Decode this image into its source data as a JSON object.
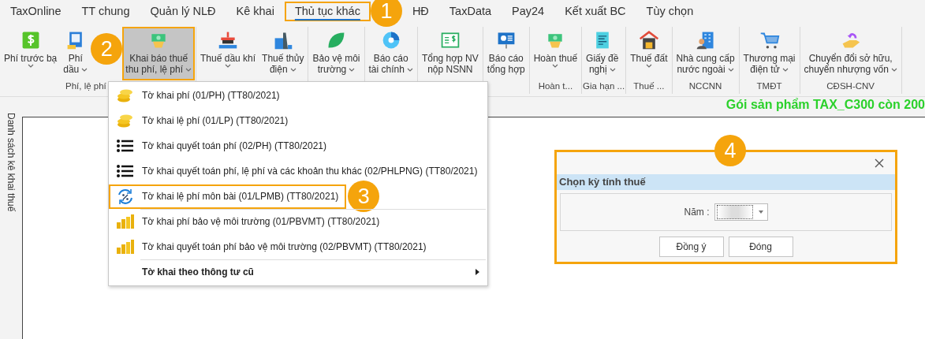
{
  "tabs": [
    {
      "label": "TaxOnline",
      "selected": false,
      "highlighted": false
    },
    {
      "label": "TT chung",
      "selected": false,
      "highlighted": false
    },
    {
      "label": "Quản lý NLĐ",
      "selected": false,
      "highlighted": false
    },
    {
      "label": "Kê khai",
      "selected": false,
      "highlighted": false
    },
    {
      "label": "Thủ tục khác",
      "selected": true,
      "highlighted": true,
      "callout": "1"
    },
    {
      "label": "HĐ",
      "selected": false,
      "highlighted": false
    },
    {
      "label": "TaxData",
      "selected": false,
      "highlighted": false
    },
    {
      "label": "Pay24",
      "selected": false,
      "highlighted": false
    },
    {
      "label": "Kết xuất BC",
      "selected": false,
      "highlighted": false
    },
    {
      "label": "Tùy chọn",
      "selected": false,
      "highlighted": false
    }
  ],
  "ribbon": {
    "groups": [
      {
        "label": "Phí, lệ phí",
        "buttons": [
          {
            "lines": [
              "Phí trước bạ"
            ],
            "dropdown": true,
            "highlighted": false
          },
          {
            "lines": [
              "Phí",
              "dầu"
            ],
            "dropdown": true,
            "highlighted": false
          },
          {
            "lines": [
              "Khai báo thuế",
              "thu phí, lệ phí"
            ],
            "dropdown": true,
            "highlighted": true,
            "callout": "2"
          }
        ]
      },
      {
        "buttons": [
          {
            "lines": [
              "Thuế dầu khí"
            ],
            "dropdown": true,
            "highlighted": false
          },
          {
            "lines": [
              "Thuế thủy",
              "điện"
            ],
            "dropdown": true,
            "highlighted": false
          }
        ]
      },
      {
        "buttons": [
          {
            "lines": [
              "Bảo vệ môi",
              "trường"
            ],
            "dropdown": true,
            "highlighted": false
          }
        ]
      },
      {
        "buttons": [
          {
            "lines": [
              "Báo cáo",
              "tài chính"
            ],
            "dropdown": true,
            "highlighted": false
          }
        ]
      },
      {
        "buttons": [
          {
            "lines": [
              "Tổng hợp NV",
              "nộp NSNN"
            ],
            "dropdown": false,
            "highlighted": false
          }
        ]
      },
      {
        "buttons": [
          {
            "lines": [
              "Báo cáo",
              "tổng hợp"
            ],
            "dropdown": false,
            "highlighted": false
          }
        ]
      },
      {
        "label": "Hoàn t...",
        "buttons": [
          {
            "lines": [
              "Hoàn thuế"
            ],
            "dropdown": true,
            "highlighted": false
          }
        ]
      },
      {
        "label": "Gia hạn ...",
        "buttons": [
          {
            "lines": [
              "Giấy đề",
              "nghị"
            ],
            "dropdown": true,
            "highlighted": false
          }
        ]
      },
      {
        "label": "Thuế ...",
        "buttons": [
          {
            "lines": [
              "Thuế đất"
            ],
            "dropdown": true,
            "highlighted": false
          }
        ]
      },
      {
        "label": "NCCNN",
        "buttons": [
          {
            "lines": [
              "Nhà cung cấp",
              "nước ngoài"
            ],
            "dropdown": true,
            "highlighted": false
          }
        ]
      },
      {
        "label": "TMĐT",
        "buttons": [
          {
            "lines": [
              "Thương mại",
              "điện tử"
            ],
            "dropdown": true,
            "highlighted": false
          }
        ]
      },
      {
        "label": "CĐSH-CNV",
        "buttons": [
          {
            "lines": [
              "Chuyển đổi sở hữu,",
              "chuyển nhượng vốn"
            ],
            "dropdown": true,
            "highlighted": false
          }
        ]
      }
    ]
  },
  "notice": "Gói sản phẩm TAX_C300 còn 200",
  "sidebar": {
    "title": "Danh sách kê khai thuế"
  },
  "menu": {
    "items": [
      {
        "kind": "item",
        "label": "Tờ khai phí (01/PH) (TT80/2021)",
        "highlighted": false,
        "separator_before": false
      },
      {
        "kind": "item",
        "label": "Tờ khai lệ phí (01/LP) (TT80/2021)",
        "highlighted": false,
        "separator_before": false
      },
      {
        "kind": "item",
        "label": "Tờ khai quyết toán phí (02/PH) (TT80/2021)",
        "highlighted": false,
        "separator_before": false
      },
      {
        "kind": "item",
        "label": "Tờ khai quyết toán phí, lệ phí và các khoản thu khác (02/PHLPNG) (TT80/2021)",
        "highlighted": false,
        "separator_before": false
      },
      {
        "kind": "item",
        "label": "Tờ khai lệ phí môn bài (01/LPMB) (TT80/2021)",
        "highlighted": true,
        "separator_before": false,
        "callout": "3"
      },
      {
        "kind": "item",
        "label": "Tờ khai phí bảo vệ môi trường (01/PBVMT) (TT80/2021)",
        "highlighted": false,
        "separator_before": true
      },
      {
        "kind": "item",
        "label": "Tờ khai quyết toán phí bảo vệ môi trường (02/PBVMT) (TT80/2021)",
        "highlighted": false,
        "separator_before": false
      },
      {
        "kind": "submenu",
        "label": "Tờ khai theo thông tư cũ",
        "highlighted": false,
        "separator_before": true
      }
    ]
  },
  "dialog": {
    "title": "Chọn kỳ tính thuế",
    "highlighted": true,
    "callout": "4",
    "field": {
      "label": "Năm :"
    },
    "buttons": [
      "Đồng ý",
      "Đóng"
    ]
  }
}
